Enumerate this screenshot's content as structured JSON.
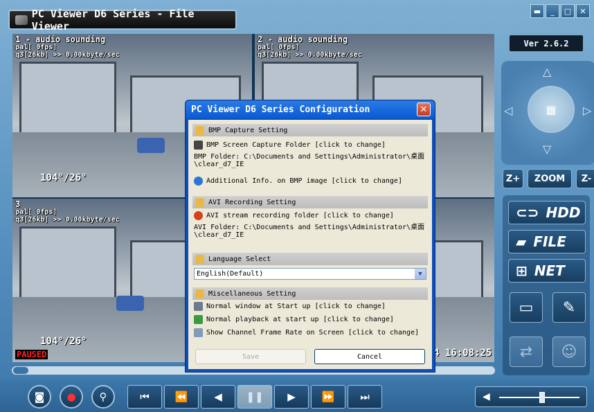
{
  "window": {
    "title": "PC Viewer D6 Series - File Viewer",
    "version": "Ver 2.6.2"
  },
  "cameras": [
    {
      "id": "1",
      "name": "1 - audio sounding",
      "line2": "pal[ 0fps]",
      "line3": "q3[26kb] >> 0.00kbyte/sec",
      "temp": "104°/26°"
    },
    {
      "id": "2",
      "name": "2 - audio sounding",
      "line2": "pal[ 0fps]",
      "line3": "q3[26kb] >> 0.00kbyte/sec"
    },
    {
      "id": "3",
      "name": "3",
      "line2": "pal[ 0fps]",
      "line3": "q3[26kb] >> 0.00kbyte/sec",
      "temp": "104°/26°"
    }
  ],
  "status": {
    "paused": "PAUSED",
    "clock": "4 16:08:25"
  },
  "ptz": {
    "zoom_in": "Z+",
    "zoom": "ZOOM",
    "zoom_out": "Z-"
  },
  "side": {
    "hdd": "HDD",
    "file": "FILE",
    "net": "NET"
  },
  "dialog": {
    "title": "PC Viewer D6 Series Configuration",
    "bmp": {
      "header": "BMP Capture Setting",
      "folder_btn": "BMP Screen Capture Folder [click to change]",
      "folder_line1": "BMP Folder: C:\\Documents and Settings\\Administrator\\桌面",
      "folder_line2": "\\clear_d7_IE",
      "info": "Additional Info. on BMP image [click to change]"
    },
    "avi": {
      "header": "AVI Recording Setting",
      "folder_btn": "AVI stream recording folder [click to change]",
      "folder_line1": "AVI Folder: C:\\Documents and Settings\\Administrator\\桌面",
      "folder_line2": "\\clear_d7_IE"
    },
    "lang": {
      "header": "Language Select",
      "value": "English(Default)"
    },
    "misc": {
      "header": "Miscellaneous Setting",
      "opt1": "Normal window at Start up [click to change]",
      "opt2": "Normal playback at start up [click to change]",
      "opt3": "Show Channel Frame Rate on Screen [click to change]"
    },
    "save": "Save",
    "cancel": "Cancel"
  },
  "icons": {
    "camera": "camera-icon",
    "record": "record-icon",
    "search": "search-icon",
    "volume": "speaker-icon"
  }
}
